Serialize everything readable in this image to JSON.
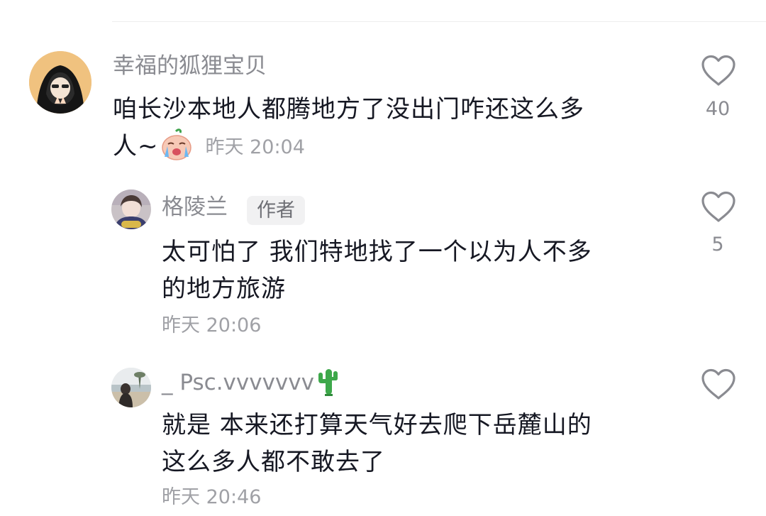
{
  "comments": [
    {
      "username": "幸福的狐狸宝贝",
      "text_line1": "咱长沙本地人都腾地方了没出门咋还这么多",
      "text_line2": "人~",
      "timestamp": "昨天 20:04",
      "likes": "40",
      "avatar_icon": "hooded-girl-avatar",
      "emoji_icon": "crying-face-emoji"
    },
    {
      "username": "格陵兰",
      "author_badge": "作者",
      "text_line1": "太可怕了 我们特地找了一个以为人不多",
      "text_line2": "的地方旅游",
      "timestamp": "昨天 20:06",
      "likes": "5",
      "avatar_icon": "photo-avatar"
    },
    {
      "username": "_ Psc.vvvvvvv",
      "username_emoji": "cactus-icon",
      "text_line1": "就是  本来还打算天气好去爬下岳麓山的",
      "text_line2": "这么多人都不敢去了",
      "timestamp": "昨天 20:46",
      "avatar_icon": "beach-photo-avatar"
    }
  ],
  "colors": {
    "username": "#8a8b91",
    "body_text": "#161823",
    "timestamp": "#a0a1a6",
    "heart_outline": "#8a8b91",
    "badge_bg": "#f1f1f2"
  }
}
